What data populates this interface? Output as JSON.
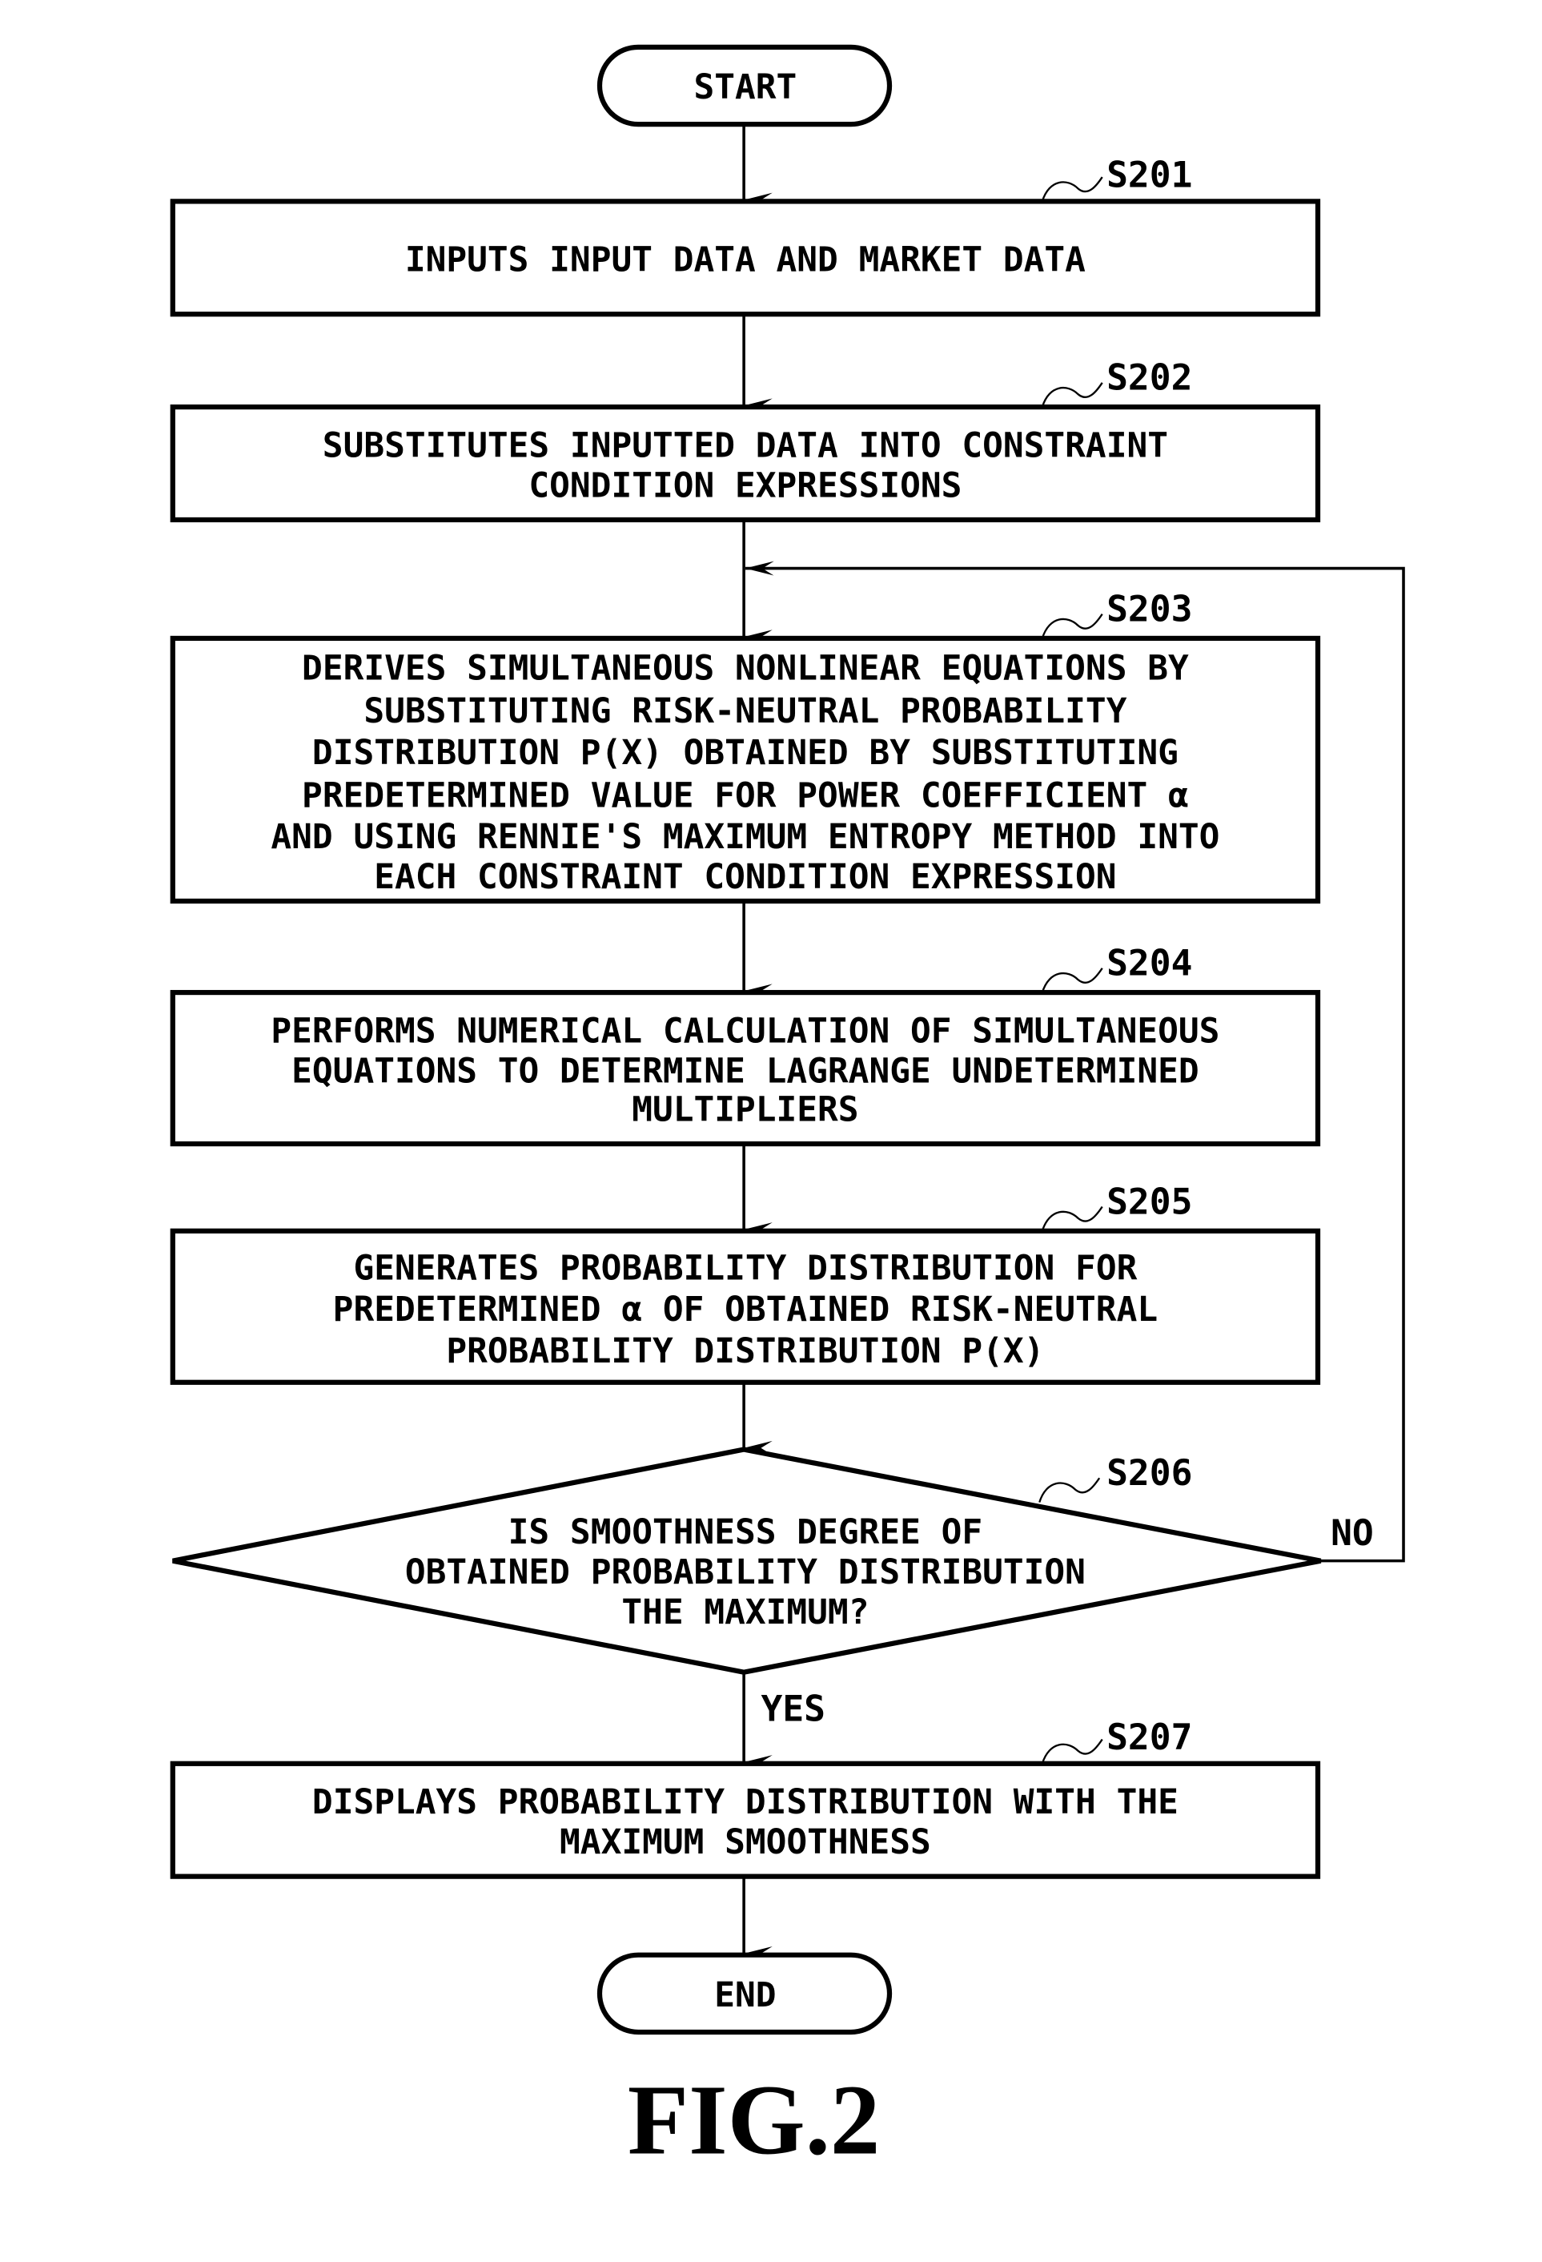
{
  "figure_label": "FIG.2",
  "terminals": {
    "start": "START",
    "end": "END"
  },
  "steps": [
    {
      "id": "S201",
      "lines": [
        "INPUTS INPUT DATA AND MARKET DATA"
      ]
    },
    {
      "id": "S202",
      "lines": [
        "SUBSTITUTES INPUTTED DATA INTO CONSTRAINT",
        "CONDITION EXPRESSIONS"
      ]
    },
    {
      "id": "S203",
      "lines": [
        "DERIVES SIMULTANEOUS NONLINEAR EQUATIONS BY",
        "SUBSTITUTING RISK-NEUTRAL PROBABILITY",
        "DISTRIBUTION P(X) OBTAINED BY SUBSTITUTING",
        "PREDETERMINED VALUE FOR POWER COEFFICIENT α",
        "AND USING RENNIE'S MAXIMUM ENTROPY METHOD INTO",
        "EACH CONSTRAINT CONDITION EXPRESSION"
      ]
    },
    {
      "id": "S204",
      "lines": [
        "PERFORMS NUMERICAL CALCULATION OF SIMULTANEOUS",
        "EQUATIONS TO DETERMINE LAGRANGE UNDETERMINED",
        "MULTIPLIERS"
      ]
    },
    {
      "id": "S205",
      "lines": [
        "GENERATES PROBABILITY DISTRIBUTION FOR",
        "PREDETERMINED α OF OBTAINED RISK-NEUTRAL",
        "PROBABILITY DISTRIBUTION P(X)"
      ]
    },
    {
      "id": "S206",
      "lines": [
        "IS SMOOTHNESS DEGREE OF",
        "OBTAINED PROBABILITY DISTRIBUTION",
        "THE MAXIMUM?"
      ]
    },
    {
      "id": "S207",
      "lines": [
        "DISPLAYS PROBABILITY DISTRIBUTION WITH THE",
        "MAXIMUM SMOOTHNESS"
      ]
    }
  ],
  "branches": {
    "yes": "YES",
    "no": "NO"
  }
}
